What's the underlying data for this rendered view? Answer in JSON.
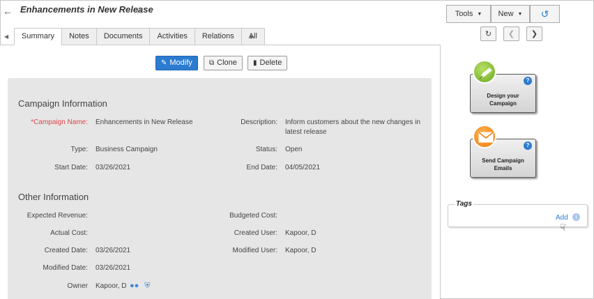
{
  "header": {
    "title": "Enhancements in New Release"
  },
  "tabs": [
    {
      "label": "Summary"
    },
    {
      "label": "Notes"
    },
    {
      "label": "Documents"
    },
    {
      "label": "Activities"
    },
    {
      "label": "Relations"
    },
    {
      "label": "All"
    }
  ],
  "actions": {
    "modify": "Modify",
    "clone": "Clone",
    "delete": "Delete"
  },
  "campaign_info": {
    "title": "Campaign Information",
    "name_label": "*Campaign Name:",
    "name_value": "Enhancements in New Release",
    "description_label": "Description:",
    "description_value": "Inform customers about the new changes in latest release",
    "type_label": "Type:",
    "type_value": "Business Campaign",
    "status_label": "Status:",
    "status_value": "Open",
    "start_label": "Start Date:",
    "start_value": "03/26/2021",
    "end_label": "End Date:",
    "end_value": "04/05/2021"
  },
  "other_info": {
    "title": "Other Information",
    "expected_revenue_label": "Expected Revenue:",
    "budgeted_cost_label": "Budgeted Cost:",
    "actual_cost_label": "Actual Cost:",
    "created_user_label": "Created User:",
    "created_user_value": "Kapoor, D",
    "created_date_label": "Created Date:",
    "created_date_value": "03/26/2021",
    "modified_user_label": "Modified User:",
    "modified_user_value": "Kapoor, D",
    "modified_date_label": "Modified Date:",
    "modified_date_value": "03/26/2021",
    "owner_label": "Owner",
    "owner_value": "Kapoor, D"
  },
  "toolbar": {
    "tools": "Tools",
    "new": "New"
  },
  "widgets": {
    "design_line1": "Design your",
    "design_line2": "Campaign",
    "email_line1": "Send Campaign",
    "email_line2": "Emails",
    "help": "?"
  },
  "tags": {
    "title": "Tags",
    "add": "Add",
    "info": "i"
  },
  "colors": {
    "accent": "#2b7bd1",
    "required": "#e0464a",
    "panel": "#e6e6e6"
  }
}
